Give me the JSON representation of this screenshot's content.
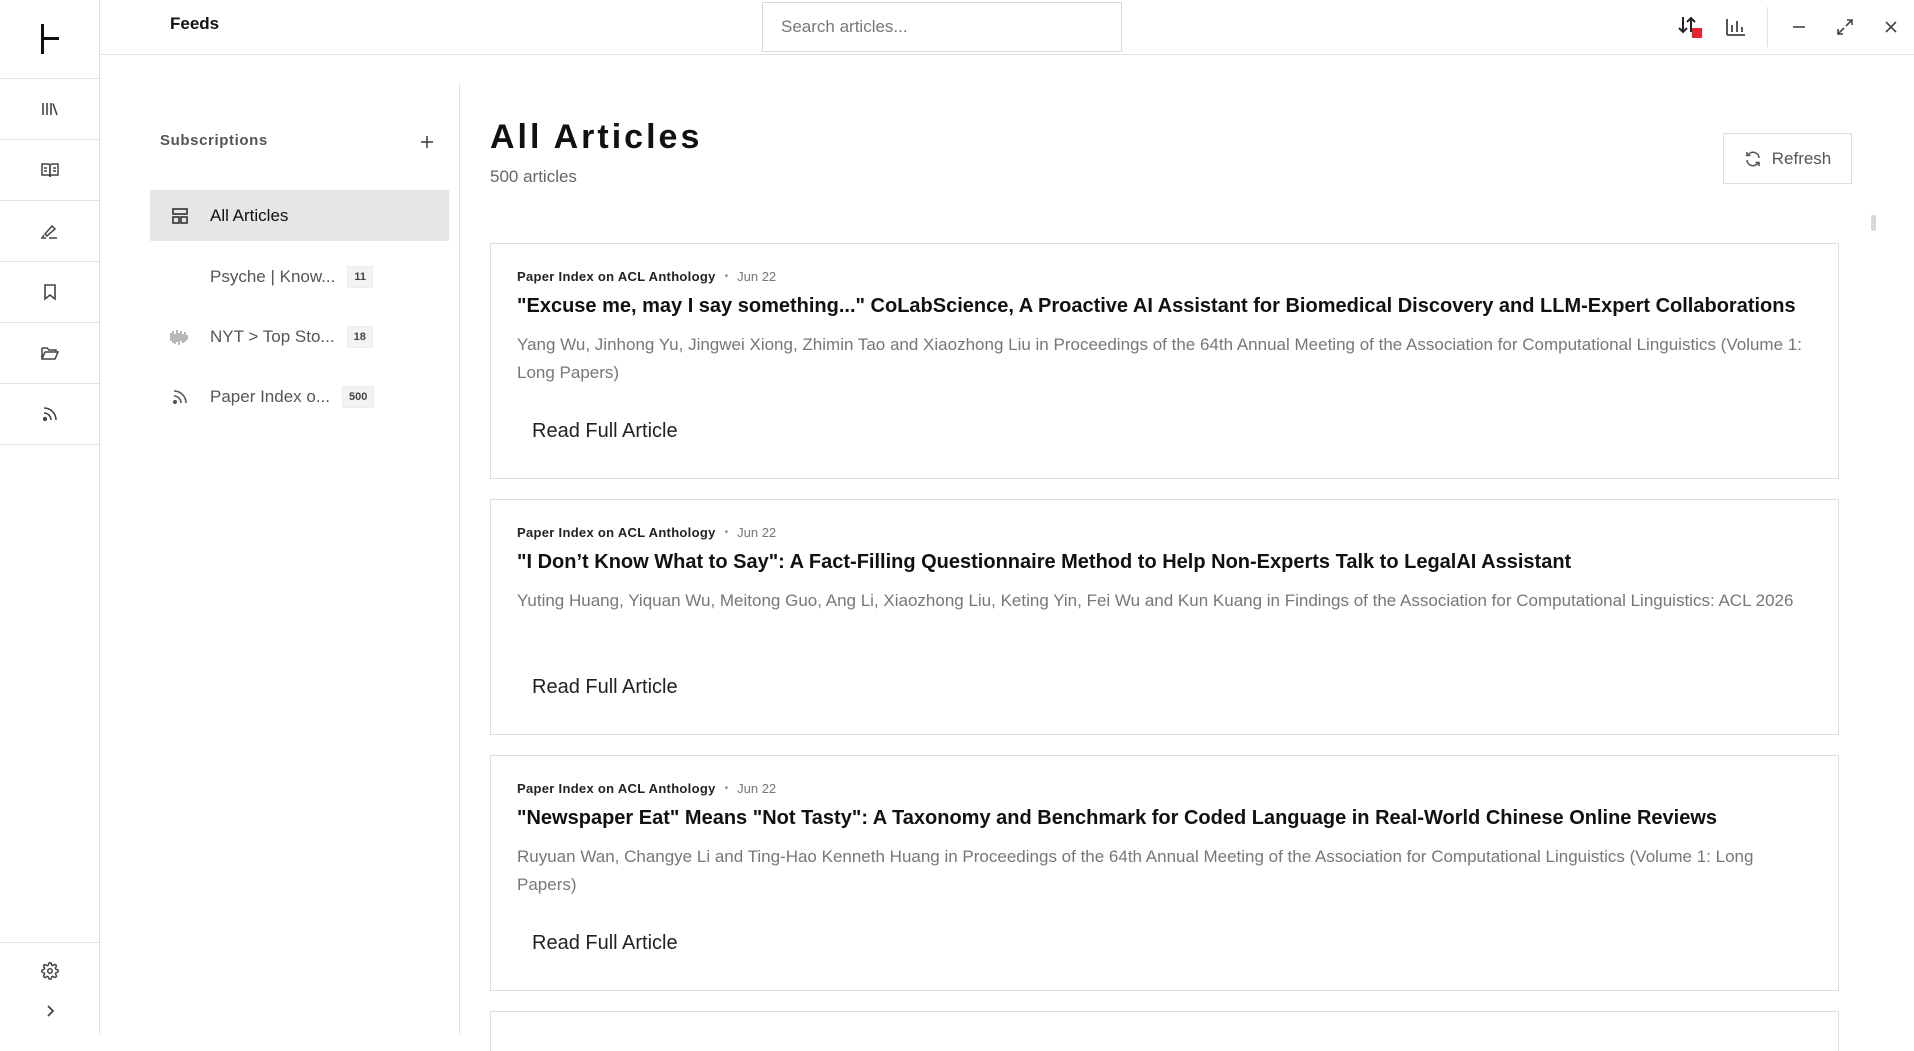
{
  "topbar": {
    "title": "Feeds",
    "search_placeholder": "Search articles..."
  },
  "subscriptions": {
    "header": "Subscriptions",
    "items": [
      {
        "label": "All Articles",
        "icon": "layout-grid-icon",
        "count": "",
        "active": true
      },
      {
        "label": "Psyche | Know...",
        "icon": "",
        "count": "11",
        "active": false
      },
      {
        "label": "NYT > Top Sto...",
        "icon": "nyt-favicon-icon",
        "count": "18",
        "active": false
      },
      {
        "label": "Paper Index o...",
        "icon": "rss-icon",
        "count": "500",
        "active": false
      }
    ]
  },
  "main": {
    "title": "All Articles",
    "count_text": "500 articles",
    "refresh_label": "Refresh"
  },
  "articles": [
    {
      "source": "Paper Index on ACL Anthology",
      "date": "Jun 22",
      "title": "\"Excuse me, may I say something...\" CoLabScience, A Proactive AI Assistant for Biomedical Discovery and LLM-Expert Collaborations",
      "description": "Yang Wu, Jinhong Yu, Jingwei Xiong, Zhimin Tao and Xiaozhong Liu in Proceedings of the 64th Annual Meeting of the Association for Computational Linguistics (Volume 1: Long Papers)",
      "read_label": "Read Full Article"
    },
    {
      "source": "Paper Index on ACL Anthology",
      "date": "Jun 22",
      "title": "\"I Don’t Know What to Say\": A Fact-Filling Questionnaire Method to Help Non-Experts Talk to LegalAI Assistant",
      "description": "Yuting Huang, Yiquan Wu, Meitong Guo, Ang Li, Xiaozhong Liu, Keting Yin, Fei Wu and Kun Kuang in Findings of the Association for Computational Linguistics: ACL 2026",
      "read_label": "Read Full Article"
    },
    {
      "source": "Paper Index on ACL Anthology",
      "date": "Jun 22",
      "title": "\"Newspaper Eat\" Means \"Not Tasty\": A Taxonomy and Benchmark for Coded Language in Real-World Chinese Online Reviews",
      "description": "Ruyuan Wan, Changye Li and Ting-Hao Kenneth Huang in Proceedings of the 64th Annual Meeting of the Association for Computational Linguistics (Volume 1: Long Papers)",
      "read_label": "Read Full Article"
    }
  ],
  "colors": {
    "accent_red": "#e8242c",
    "active_bg": "#e6e6e6",
    "border": "#e2e2e2"
  }
}
